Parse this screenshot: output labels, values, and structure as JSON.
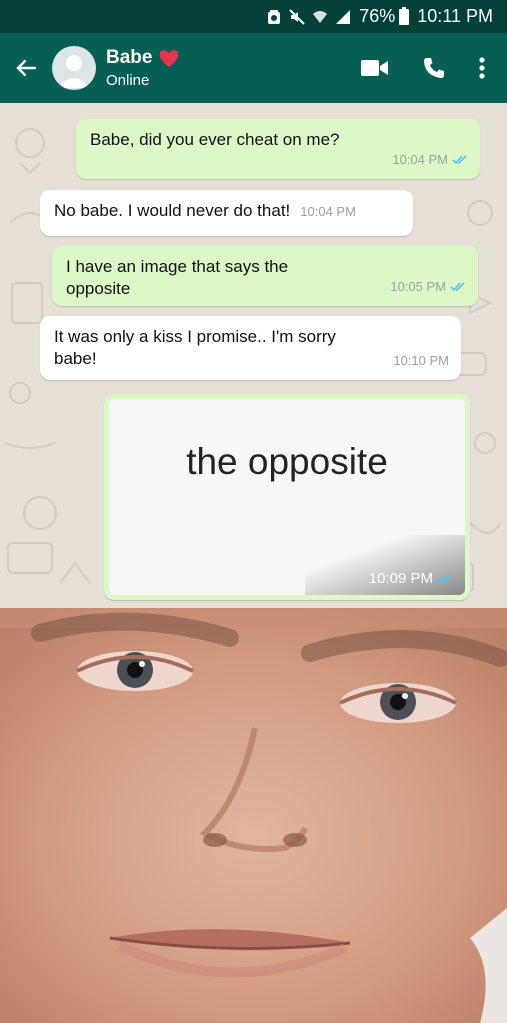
{
  "status_bar": {
    "battery": "76%",
    "time": "10:11 PM",
    "icons": [
      "alarm-icon",
      "mute-icon",
      "wifi-icon",
      "signal-icon",
      "battery-icon"
    ]
  },
  "header": {
    "contact_name": "Babe",
    "status": "Online",
    "icons": [
      "back-arrow-icon",
      "heart-icon",
      "video-call-icon",
      "phone-icon",
      "more-vert-icon"
    ]
  },
  "messages": [
    {
      "direction": "outgoing",
      "text": "Babe, did you ever cheat on me?",
      "time": "10:04 PM",
      "read": true
    },
    {
      "direction": "incoming",
      "text": "No babe. I would never do that!",
      "time": "10:04 PM"
    },
    {
      "direction": "outgoing",
      "text": "I have an image that says the opposite",
      "time": "10:05 PM",
      "read": true
    },
    {
      "direction": "incoming",
      "text": "It was only a kiss I promise.. I'm sorry babe!",
      "time": "10:10 PM"
    },
    {
      "direction": "outgoing",
      "type": "image",
      "image_text": "the opposite",
      "time": "10:09 PM",
      "read": true
    }
  ],
  "colors": {
    "status_bar": "#04403a",
    "header": "#075e54",
    "outgoing_bubble": "#dcf8c6",
    "incoming_bubble": "#ffffff",
    "chat_background": "#e6dfd6",
    "read_ticks": "#4fc3f7"
  }
}
